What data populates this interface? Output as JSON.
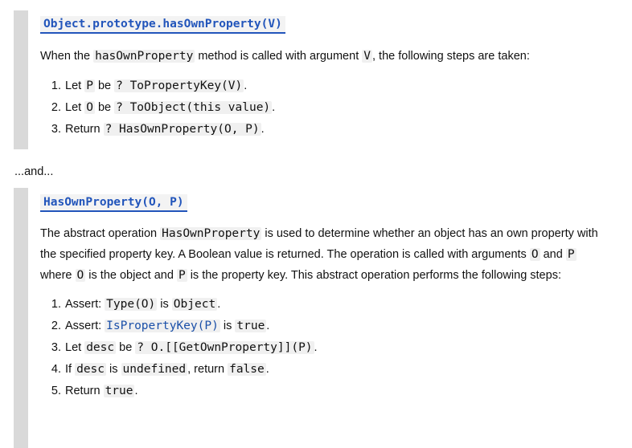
{
  "block1": {
    "heading": "Object.prototype.hasOwnProperty(V)",
    "intro": {
      "t1": "When the ",
      "c1": "hasOwnProperty",
      "t2": " method is called with argument ",
      "c2": "V",
      "t3": ", the following steps are taken:"
    },
    "steps": [
      {
        "a": "Let ",
        "b": "P",
        "c": " be ",
        "d": "? ToPropertyKey(V)",
        "e": "."
      },
      {
        "a": "Let ",
        "b": "O",
        "c": " be ",
        "d": "? ToObject(this value)",
        "e": "."
      },
      {
        "a": "Return ",
        "d": "? HasOwnProperty(O, P)",
        "e": "."
      }
    ]
  },
  "separator": "...and...",
  "block2": {
    "heading": "HasOwnProperty(O, P)",
    "para": {
      "t1": "The abstract operation ",
      "c1": "HasOwnProperty",
      "t2": " is used to determine whether an object has an own property with the specified property key. A Boolean value is returned. The operation is called with arguments ",
      "c2": "O",
      "t3": " and ",
      "c3": "P",
      "t4": " where ",
      "c4": "O",
      "t5": " is the object and ",
      "c5": "P",
      "t6": " is the property key. This abstract operation performs the following steps:"
    },
    "steps": {
      "s1": {
        "a": "Assert: ",
        "b": "Type(O)",
        "c": " is ",
        "d": "Object",
        "e": "."
      },
      "s2": {
        "a": "Assert: ",
        "b": "IsPropertyKey(P)",
        "c": " is ",
        "d": "true",
        "e": "."
      },
      "s3": {
        "a": "Let ",
        "b": "desc",
        "c": " be ",
        "d": "? O.[[GetOwnProperty]](P)",
        "e": "."
      },
      "s4": {
        "a": "If ",
        "b": "desc",
        "c": " is ",
        "d": "undefined",
        "f": ", return ",
        "g": "false",
        "e": "."
      },
      "s5": {
        "a": "Return ",
        "b": "true",
        "e": "."
      }
    }
  }
}
